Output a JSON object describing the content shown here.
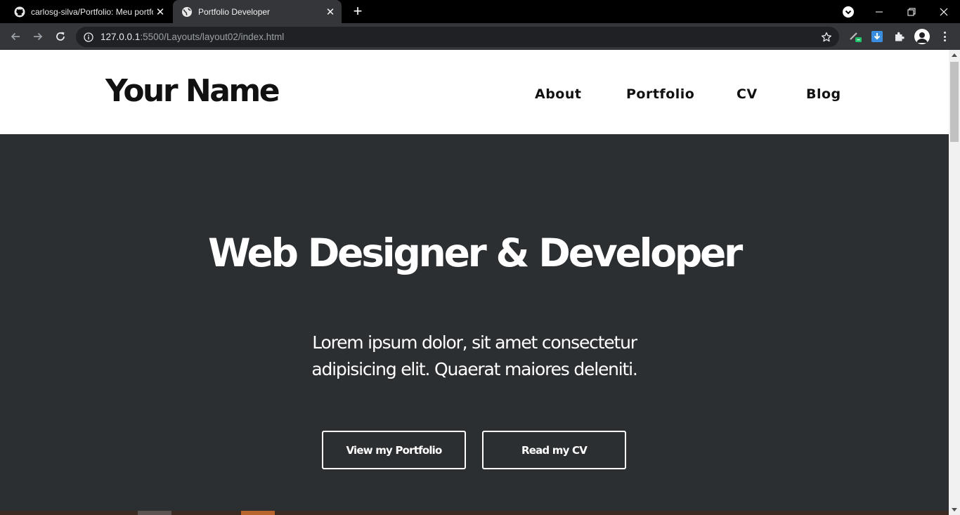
{
  "browser": {
    "tabs": [
      {
        "title": "carlosg-silva/Portfolio: Meu portfólio",
        "icon": "github-icon",
        "active": false
      },
      {
        "title": "Portfolio Developer",
        "icon": "globe-icon",
        "active": true
      }
    ],
    "url": {
      "host": "127.0.0.1",
      "rest": ":5500/Layouts/layout02/index.html"
    },
    "colors": {
      "tabbar": "#000000",
      "toolbar": "#35363a",
      "omnibox": "#202124"
    }
  },
  "page": {
    "brand": "Your Name",
    "nav": [
      {
        "label": "About"
      },
      {
        "label": "Portfolio"
      },
      {
        "label": "CV"
      },
      {
        "label": "Blog"
      }
    ],
    "hero": {
      "title": "Web Designer & Developer",
      "text_line1": "Lorem ipsum dolor, sit amet consectetur",
      "text_line2": "adipisicing elit. Quaerat maiores deleniti.",
      "buttons": [
        {
          "label": "View my Portfolio"
        },
        {
          "label": "Read my CV"
        }
      ]
    },
    "colors": {
      "header_bg": "#ffffff",
      "hero_bg": "#2b2f31",
      "text": "#ffffff"
    }
  }
}
